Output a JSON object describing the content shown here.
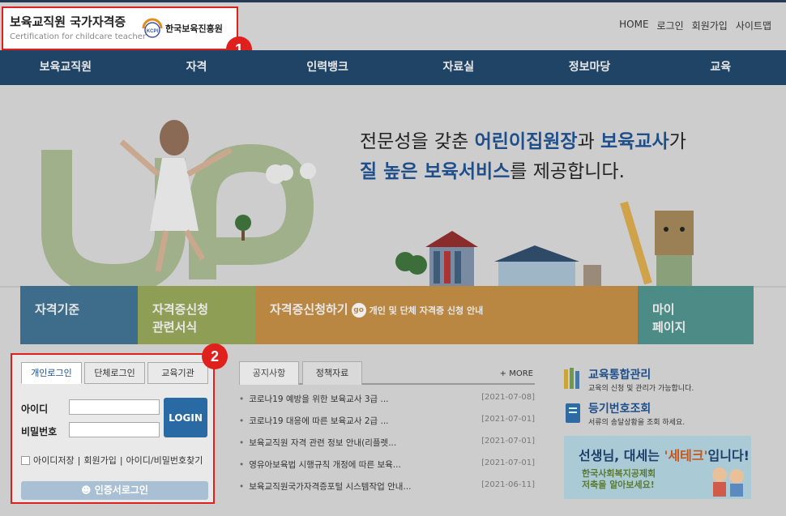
{
  "header": {
    "logo_title": "보육교직원 국가자격증",
    "logo_subtitle": "Certification for childcare teacher",
    "kcpi_label": "한국보육진흥원",
    "kcpi_mark": "KCPI",
    "top_links": [
      "HOME",
      "로그인",
      "회원가입",
      "사이트맵"
    ]
  },
  "annotations": {
    "badge1": "1",
    "badge2": "2"
  },
  "main_nav": [
    "보육교직원",
    "자격",
    "인력뱅크",
    "자료실",
    "정보마당",
    "교육"
  ],
  "hero": {
    "line1_pre": "전문성을 갖춘 ",
    "line1_b1": "어린이집원장",
    "line1_mid": "과 ",
    "line1_b2": "보육교사",
    "line1_post": "가",
    "line2_b": "질 높은 보육서비스",
    "line2_post": "를 제공합니다."
  },
  "tiles": {
    "t1": "자격기준",
    "t2_line1": "자격증신청",
    "t2_line2": "관련서식",
    "t3_title": "자격증신청하기",
    "t3_go": "go",
    "t3_desc": "개인 및 단체 자격증 신청 안내",
    "t4_line1": "마이",
    "t4_line2": "페이지"
  },
  "login": {
    "tabs": [
      "개인로그인",
      "단체로그인",
      "교육기관"
    ],
    "id_label": "아이디",
    "pw_label": "비밀번호",
    "login_button": "LOGIN",
    "save_id": "아이디저장",
    "join": "회원가입",
    "find": "아이디/비밀번호찾기",
    "cert_login": "인증서로그인"
  },
  "notice": {
    "tabs": [
      "공지사항",
      "정책자료"
    ],
    "more": "+ MORE",
    "items": [
      {
        "title": "코로나19 예방을 위한 보육교사 3급 ...",
        "date": "[2021-07-08]"
      },
      {
        "title": "코로나19 대응에 따른 보육교사 2급 ...",
        "date": "[2021-07-01]"
      },
      {
        "title": "보육교직원 자격 관련 정보 안내(리플렛...",
        "date": "[2021-07-01]"
      },
      {
        "title": "영유아보육법 시행규칙 개정에 따른 보육...",
        "date": "[2021-07-01]"
      },
      {
        "title": "보육교직원국가자격증포털 시스템작업 안내...",
        "date": "[2021-06-11]"
      }
    ]
  },
  "side": {
    "item1_title": "교육통합관리",
    "item1_desc": "교육의 신청 및 관리가 가능합니다.",
    "item2_title": "등기번호조회",
    "item2_desc": "서류의 송달상황을 조회 하세요.",
    "banner_pre": "선생님, 대세는 ",
    "banner_hl": "'세테크'",
    "banner_post": "입니다!",
    "banner_line2": "한국사회복지공제회",
    "banner_line3": "저축을 알아보세요!"
  }
}
